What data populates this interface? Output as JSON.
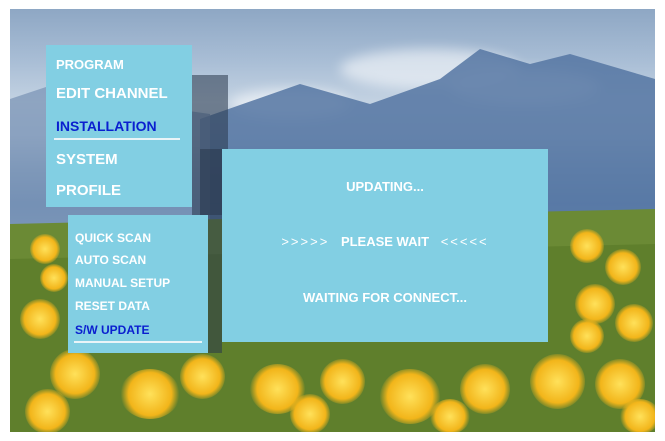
{
  "main_menu": {
    "items": [
      {
        "label": "PROGRAM",
        "active": false
      },
      {
        "label": "EDIT CHANNEL",
        "active": false
      },
      {
        "label": "INSTALLATION",
        "active": true
      },
      {
        "label": "SYSTEM",
        "active": false
      },
      {
        "label": "PROFILE",
        "active": false
      }
    ]
  },
  "sub_menu": {
    "items": [
      {
        "label": "QUICK SCAN",
        "active": false
      },
      {
        "label": "AUTO SCAN",
        "active": false
      },
      {
        "label": "MANUAL SETUP",
        "active": false
      },
      {
        "label": "RESET DATA",
        "active": false
      },
      {
        "label": "S/W UPDATE",
        "active": true
      }
    ]
  },
  "update_dialog": {
    "status": "UPDATING...",
    "left_arrows": ">>>>>",
    "wait_message": "PLEASE WAIT",
    "right_arrows": "<<<<<",
    "connection_status": "WAITING FOR CONNECT..."
  },
  "colors": {
    "panel": "#82cfe3",
    "text": "#ffffff",
    "active_text": "#0a1fcf"
  }
}
